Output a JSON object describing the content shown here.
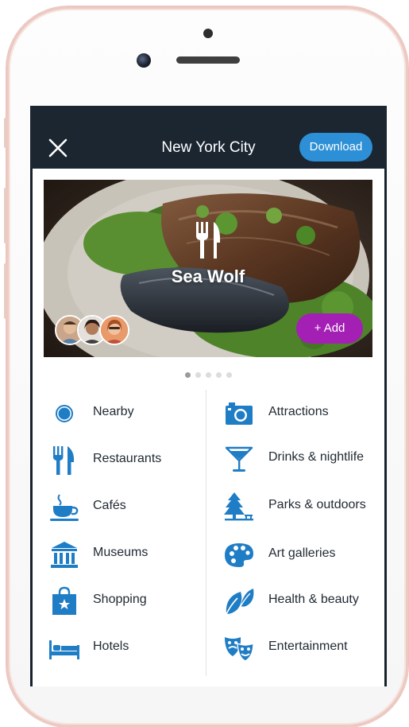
{
  "header": {
    "title": "New York City",
    "download_label": "Download"
  },
  "hero": {
    "name": "Sea Wolf",
    "add_label": "+ Add",
    "slide_count": 5,
    "active_slide": 1
  },
  "categories": {
    "left": [
      {
        "label": "Nearby",
        "icon": "location-dot-icon"
      },
      {
        "label": "Restaurants",
        "icon": "fork-knife-icon"
      },
      {
        "label": "Cafés",
        "icon": "coffee-cup-icon"
      },
      {
        "label": "Museums",
        "icon": "museum-icon"
      },
      {
        "label": "Shopping",
        "icon": "shopping-bag-icon"
      },
      {
        "label": "Hotels",
        "icon": "bed-icon"
      }
    ],
    "right": [
      {
        "label": "Attractions",
        "icon": "camera-icon"
      },
      {
        "label": "Drinks & nightlife",
        "icon": "cocktail-glass-icon"
      },
      {
        "label": "Parks & outdoors",
        "icon": "tree-icon"
      },
      {
        "label": "Art galleries",
        "icon": "palette-icon"
      },
      {
        "label": "Health & beauty",
        "icon": "leaf-icon"
      },
      {
        "label": "Entertainment",
        "icon": "theater-masks-icon"
      }
    ]
  },
  "colors": {
    "accent_blue": "#2d8fd5",
    "icon_blue": "#1f7dc5",
    "add_purple": "#a41fb4",
    "topbar": "#1b2631"
  }
}
